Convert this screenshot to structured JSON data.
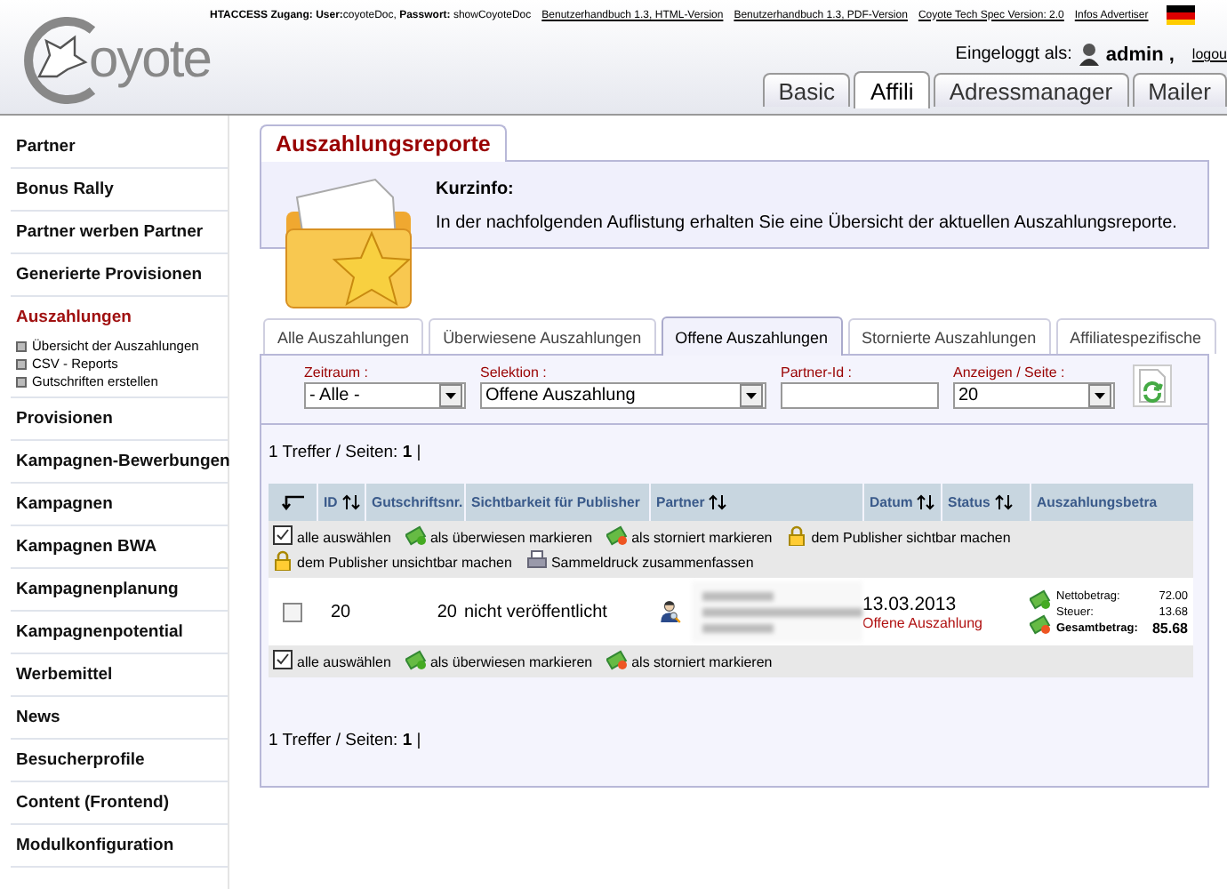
{
  "header": {
    "access_label": "HTACCESS Zugang:",
    "user_label": "User:",
    "user": "coyoteDoc,",
    "password_label": "Passwort:",
    "password": "showCoyoteDoc",
    "links": [
      "Benutzerhandbuch 1.3, HTML-Version",
      "Benutzerhandbuch 1.3, PDF-Version",
      "Coyote Tech Spec Version: 2.0",
      "Infos Advertiser"
    ],
    "logo_text": "oyote",
    "login_label": "Eingeloggt als:",
    "login_user": "admin ,",
    "logout": "logou"
  },
  "main_tabs": [
    {
      "label": "Basic",
      "selected": false
    },
    {
      "label": "Affili",
      "selected": true
    },
    {
      "label": "Adressmanager",
      "selected": false
    },
    {
      "label": "Mailer",
      "selected": false
    }
  ],
  "sidebar": {
    "items": [
      {
        "label": "Partner",
        "selected": false
      },
      {
        "label": "Bonus Rally",
        "selected": false
      },
      {
        "label": "Partner werben Partner",
        "selected": false
      },
      {
        "label": "Generierte Provisionen",
        "selected": false
      },
      {
        "label": "Auszahlungen",
        "selected": true,
        "children": [
          "Übersicht der Auszahlungen",
          "CSV - Reports",
          "Gutschriften erstellen"
        ]
      },
      {
        "label": "Provisionen",
        "selected": false
      },
      {
        "label": "Kampagnen-Bewerbungen",
        "selected": false
      },
      {
        "label": "Kampagnen",
        "selected": false
      },
      {
        "label": "Kampagnen BWA",
        "selected": false
      },
      {
        "label": "Kampagnenplanung",
        "selected": false
      },
      {
        "label": "Kampagnenpotential",
        "selected": false
      },
      {
        "label": "Werbemittel",
        "selected": false
      },
      {
        "label": "News",
        "selected": false
      },
      {
        "label": "Besucherprofile",
        "selected": false
      },
      {
        "label": "Content (Frontend)",
        "selected": false
      },
      {
        "label": "Modulkonfiguration",
        "selected": false
      }
    ]
  },
  "page": {
    "title": "Auszahlungsreporte",
    "info_title": "Kurzinfo:",
    "info_text": "In der nachfolgenden Auflistung erhalten Sie eine Übersicht der aktuellen Auszahlungsreporte."
  },
  "report_tabs": [
    {
      "label": "Alle Auszahlungen",
      "selected": false
    },
    {
      "label": "Überwiesene Auszahlungen",
      "selected": false
    },
    {
      "label": "Offene Auszahlungen",
      "selected": true
    },
    {
      "label": "Stornierte Auszahlungen",
      "selected": false
    },
    {
      "label": "Affiliatespezifische",
      "selected": false
    }
  ],
  "filters": [
    {
      "kind": "select",
      "label": "Zeitraum :",
      "value": "- Alle -"
    },
    {
      "kind": "select",
      "label": "Selektion :",
      "value": "Offene Auszahlung"
    },
    {
      "kind": "input",
      "label": "Partner-Id :"
    },
    {
      "kind": "select",
      "label": "Anzeigen / Seite :",
      "value": "20"
    }
  ],
  "summary_top": {
    "text": "1 Treffer / Seiten:",
    "page": "1",
    "separator": "|"
  },
  "table": {
    "columns": [
      {
        "label": "ID",
        "sortable": true
      },
      {
        "label": "Gutschriftsnr."
      },
      {
        "label": "Sichtbarkeit für Publisher"
      },
      {
        "label": "Partner",
        "sortable": true
      },
      {
        "label": "Datum",
        "sortable": true
      },
      {
        "label": "Status",
        "sortable": true
      },
      {
        "label": "Auszahlungsbetra"
      }
    ],
    "actions_top": [
      {
        "kind": "select_all",
        "label": "alle auswählen"
      },
      {
        "kind": "paid",
        "label": "als überwiesen markieren"
      },
      {
        "kind": "cancel",
        "label": "als storniert markieren"
      },
      {
        "kind": "visible",
        "label": "dem Publisher sichtbar machen"
      },
      {
        "kind": "invisible",
        "label": "dem Publisher unsichtbar machen"
      },
      {
        "kind": "print",
        "label": "Sammeldruck zusammenfassen"
      }
    ],
    "rows": [
      {
        "checked": false,
        "id": "20",
        "credit_no": "20",
        "visibility": "nicht veröffentlicht",
        "date": "13.03.2013",
        "status": "Offene Auszahlung",
        "amounts": [
          {
            "label": "Nettobetrag:",
            "value": "72.00",
            "total": false
          },
          {
            "label": "Steuer:",
            "value": "13.68",
            "total": false
          },
          {
            "label": "Gesamtbetrag:",
            "value": "85.68",
            "total": true
          }
        ]
      }
    ],
    "actions_bottom": [
      {
        "kind": "select_all",
        "label": "alle auswählen"
      },
      {
        "kind": "paid",
        "label": "als überwiesen markieren"
      },
      {
        "kind": "cancel",
        "label": "als storniert markieren"
      }
    ]
  },
  "summary_bottom": {
    "text": "1 Treffer / Seiten:",
    "page": "1",
    "separator": "|"
  }
}
